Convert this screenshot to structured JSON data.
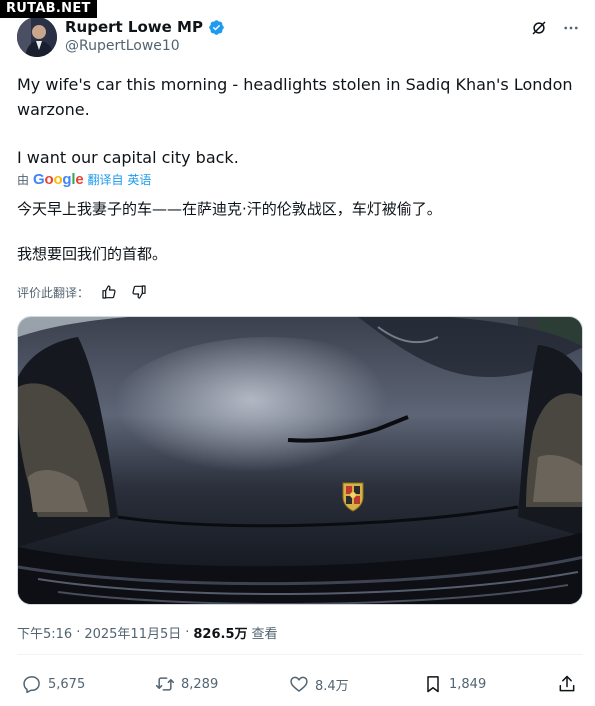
{
  "watermark": "RUTAB.NET",
  "author": {
    "display_name": "Rupert Lowe MP",
    "handle": "@RupertLowe10"
  },
  "tweet": {
    "text_line1": "My wife's car this morning - headlights stolen in Sadiq Khan's London warzone.",
    "text_line2": "I want our capital city back."
  },
  "translation_bar": {
    "prefix": "由",
    "provider": "Google",
    "link": "翻译自 英语"
  },
  "translation": {
    "line1": "今天早上我妻子的车——在萨迪克·汗的伦敦战区，车灯被偷了。",
    "line2": "我想要回我们的首都。"
  },
  "rate": {
    "label": "评价此翻译："
  },
  "meta": {
    "time": "下午5:16",
    "separator": "·",
    "date": "2025年11月5日",
    "views": "826.5万",
    "views_label": "查看"
  },
  "actions": {
    "replies": "5,675",
    "reposts": "8,289",
    "likes": "8.4万",
    "bookmarks": "1,849"
  },
  "colors": {
    "verified": "#1d9bf0",
    "link": "#1d9bf0",
    "secondary_text": "#536471"
  },
  "icons": [
    "verified-badge-icon",
    "grok-icon",
    "more-icon",
    "thumbs-up-icon",
    "thumbs-down-icon",
    "reply-icon",
    "repost-icon",
    "like-icon",
    "bookmark-icon",
    "share-icon"
  ]
}
